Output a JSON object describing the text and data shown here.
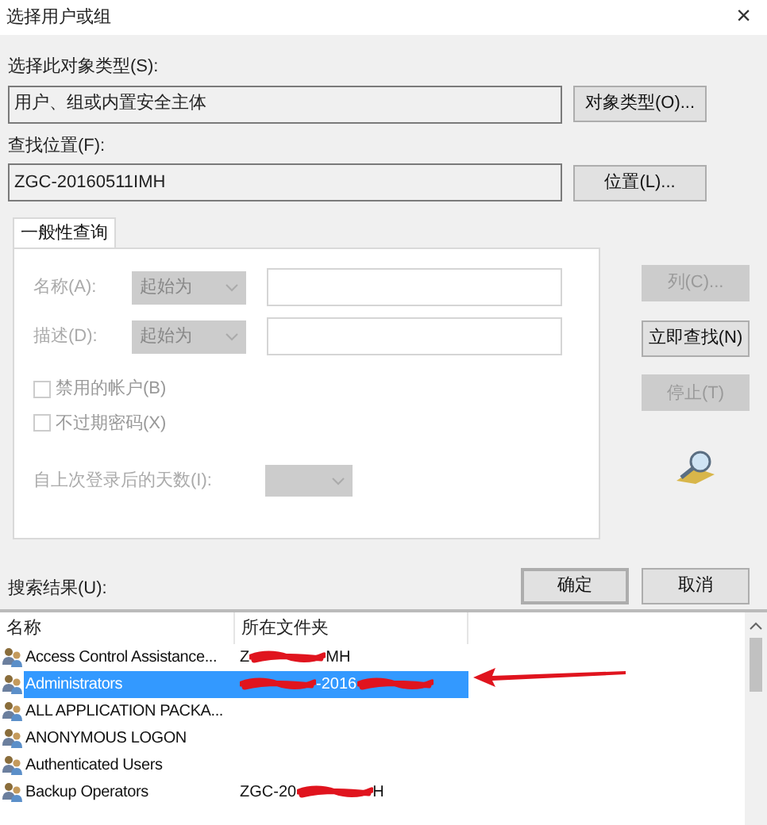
{
  "window": {
    "title": "选择用户或组",
    "close": "×"
  },
  "object_type": {
    "label": "选择此对象类型(S):",
    "value": "用户、组或内置安全主体",
    "button": "对象类型(O)..."
  },
  "location": {
    "label": "查找位置(F):",
    "value": "ZGC-20160511IMH",
    "button": "位置(L)..."
  },
  "tabs": [
    {
      "label": "一般性查询",
      "selected": true
    }
  ],
  "query": {
    "name_label": "名称(A):",
    "name_mode": "起始为",
    "desc_label": "描述(D):",
    "desc_mode": "起始为",
    "checkboxes": [
      {
        "label": "禁用的帐户(B)",
        "checked": false,
        "disabled": true
      },
      {
        "label": "不过期密码(X)",
        "checked": false,
        "disabled": true
      }
    ],
    "days_label": "自上次登录后的天数(I):"
  },
  "side_buttons": [
    {
      "label": "列(C)...",
      "disabled": true
    },
    {
      "label": "立即查找(N)",
      "disabled": false
    },
    {
      "label": "停止(T)",
      "disabled": true
    }
  ],
  "dialog_buttons": [
    {
      "label": "确定",
      "default": true
    },
    {
      "label": "取消",
      "default": false
    }
  ],
  "results": {
    "label": "搜索结果(U):",
    "columns": [
      "名称",
      "所在文件夹"
    ],
    "rows": [
      {
        "name": "Access Control Assistance...",
        "selected": false,
        "folder": [
          {
            "kind": "text",
            "text": "Z"
          },
          {
            "kind": "redaction"
          },
          {
            "kind": "text",
            "text": "MH"
          }
        ]
      },
      {
        "name": "Administrators",
        "selected": true,
        "folder": [
          {
            "kind": "redaction"
          },
          {
            "kind": "text",
            "text": "-2016"
          },
          {
            "kind": "redaction"
          }
        ]
      },
      {
        "name": "ALL APPLICATION PACKA...",
        "selected": false,
        "folder": []
      },
      {
        "name": "ANONYMOUS LOGON",
        "selected": false,
        "folder": []
      },
      {
        "name": "Authenticated Users",
        "selected": false,
        "folder": []
      },
      {
        "name": "Backup Operators",
        "selected": false,
        "folder": [
          {
            "kind": "text",
            "text": "ZGC-20"
          },
          {
            "kind": "redaction"
          },
          {
            "kind": "text",
            "text": "H"
          }
        ]
      }
    ]
  }
}
